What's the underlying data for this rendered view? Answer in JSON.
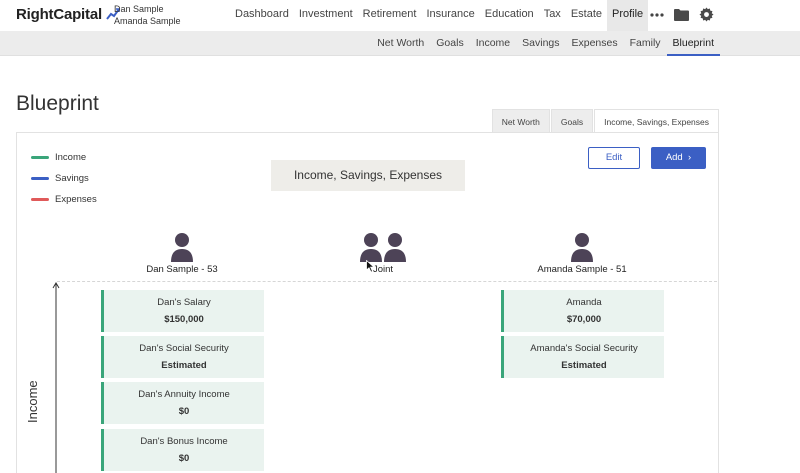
{
  "app": {
    "logo": "RightCapital",
    "users": [
      "Dan Sample",
      "Amanda Sample"
    ]
  },
  "main_nav": [
    "Dashboard",
    "Investment",
    "Retirement",
    "Insurance",
    "Education",
    "Tax",
    "Estate",
    "Profile"
  ],
  "main_nav_active": "Profile",
  "nav_icons": [
    "more-icon",
    "folder-icon",
    "gear-icon"
  ],
  "sub_nav": [
    "Net Worth",
    "Goals",
    "Income",
    "Savings",
    "Expenses",
    "Family",
    "Blueprint"
  ],
  "sub_nav_active": "Blueprint",
  "page": {
    "title": "Blueprint",
    "tabs": [
      "Net Worth",
      "Goals",
      "Income, Savings, Expenses"
    ],
    "active_tab": "Income, Savings, Expenses",
    "center_label": "Income, Savings, Expenses",
    "edit_label": "Edit",
    "add_label": "Add"
  },
  "legend": [
    {
      "label": "Income",
      "color": "#3aa57a"
    },
    {
      "label": "Savings",
      "color": "#3b5fc4"
    },
    {
      "label": "Expenses",
      "color": "#e05a5a"
    }
  ],
  "people": {
    "left": "Dan Sample - 53",
    "joint": "Joint",
    "right": "Amanda Sample - 51"
  },
  "axis_label": "Income",
  "income_cards": {
    "dan": [
      {
        "name": "Dan's Salary",
        "value": "$150,000"
      },
      {
        "name": "Dan's Social Security",
        "value": "Estimated"
      },
      {
        "name": "Dan's Annuity Income",
        "value": "$0"
      },
      {
        "name": "Dan's Bonus Income",
        "value": "$0"
      }
    ],
    "amanda": [
      {
        "name": "Amanda",
        "value": "$70,000"
      },
      {
        "name": "Amanda's Social Security",
        "value": "Estimated"
      }
    ]
  }
}
